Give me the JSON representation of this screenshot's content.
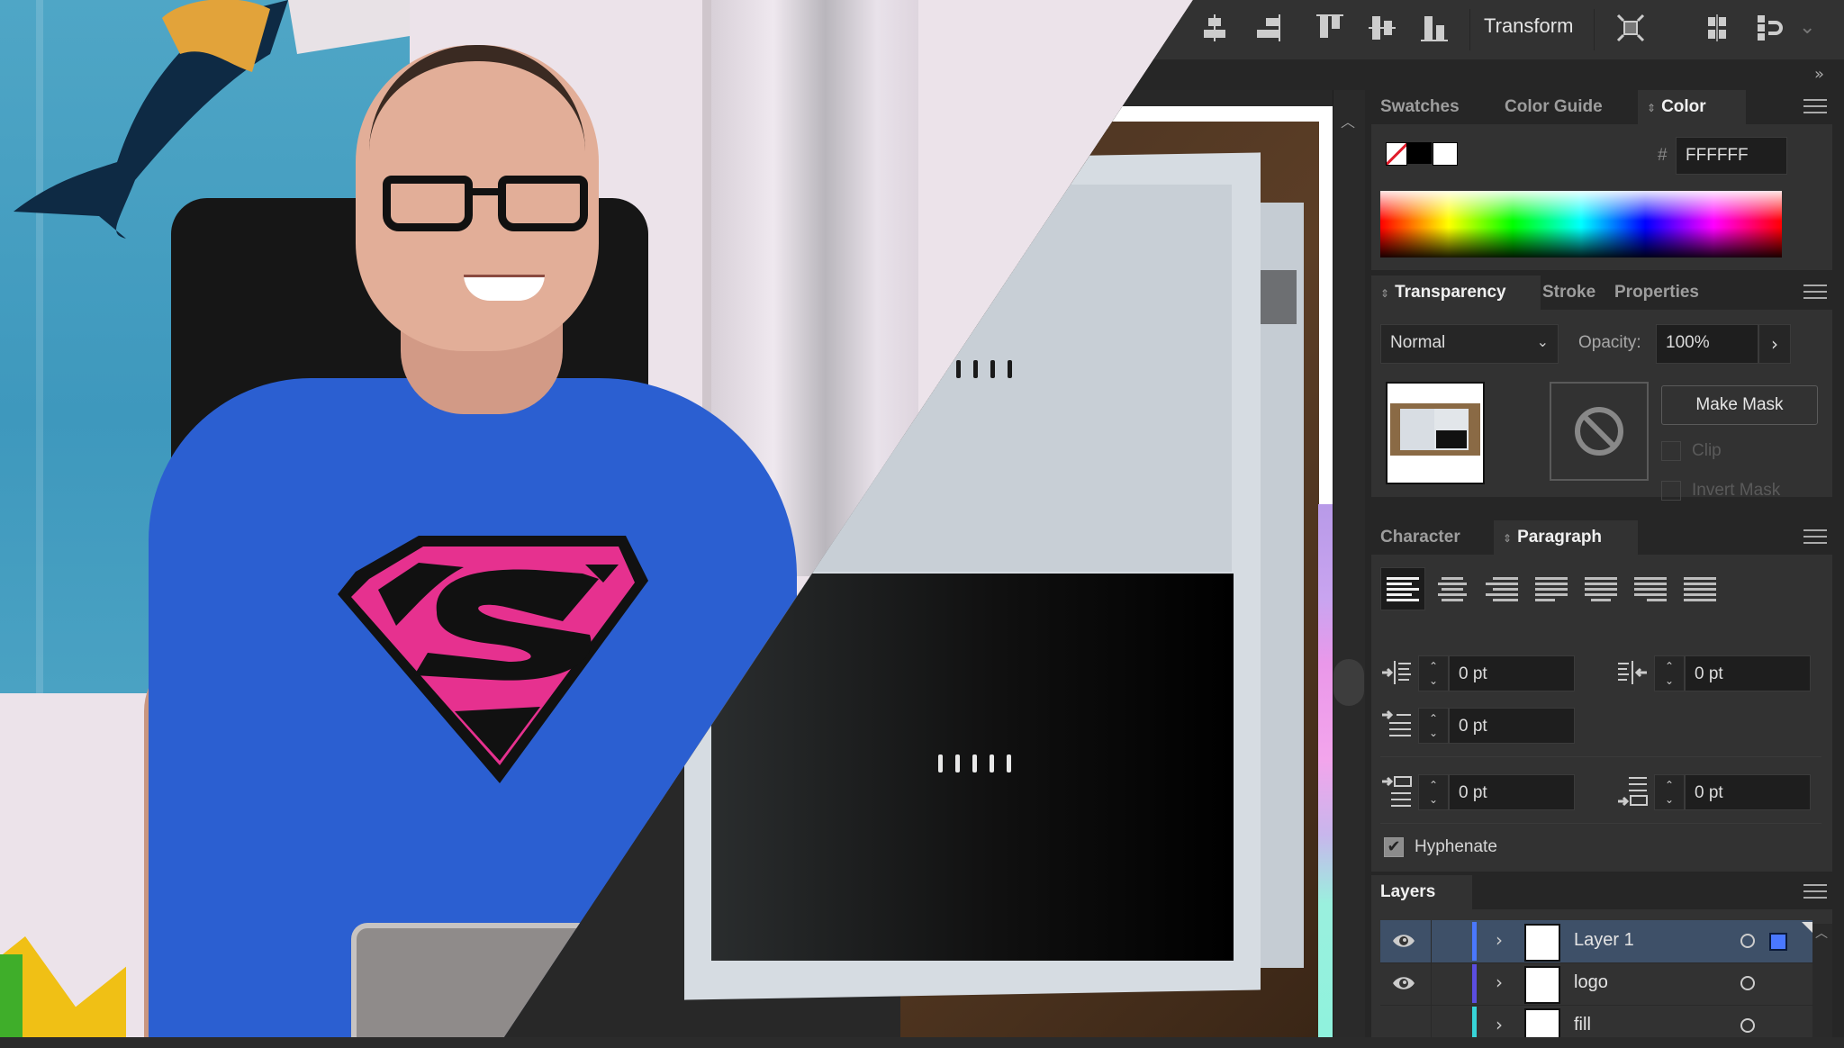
{
  "scene": {
    "description": "Presenter in a Supergirl-style t-shirt pointing at an Adobe Illustrator workspace split diagonally",
    "presenter_shirt_color": "#2b5fd1",
    "emblem_color": "#e6318f",
    "wall_color": "#ece3ea",
    "poster_color": "#4fa6c6"
  },
  "toolbar": {
    "icons": [
      {
        "name": "align-horizontal-center-icon"
      },
      {
        "name": "align-horizontal-right-icon"
      },
      {
        "name": "align-vertical-top-icon"
      },
      {
        "name": "align-vertical-center-icon"
      },
      {
        "name": "align-vertical-bottom-icon"
      }
    ],
    "transform_label": "Transform",
    "icons_after": [
      {
        "name": "isolate-selection-icon"
      },
      {
        "name": "distribute-spacing-icon"
      },
      {
        "name": "snap-magnet-icon"
      }
    ],
    "more_label": "⌄",
    "collapse_label": "»"
  },
  "color_panel": {
    "tabs": [
      {
        "label": "Swatches",
        "active": false
      },
      {
        "label": "Color Guide",
        "active": false
      },
      {
        "label": "Color",
        "active": true
      }
    ],
    "hash_label": "#",
    "hex_value": "FFFFFF",
    "fill_stroke": {
      "none": "none",
      "stroke": "#000000",
      "fill": "#FFFFFF"
    }
  },
  "transparency_panel": {
    "tabs": [
      {
        "label": "Transparency",
        "active": true
      },
      {
        "label": "Stroke",
        "active": false
      },
      {
        "label": "Properties",
        "active": false
      }
    ],
    "blend_mode": "Normal",
    "opacity_label": "Opacity:",
    "opacity_value": "100%",
    "make_mask_label": "Make Mask",
    "clip_label": "Clip",
    "invert_mask_label": "Invert Mask"
  },
  "paragraph_panel": {
    "tabs": [
      {
        "label": "Character",
        "active": false
      },
      {
        "label": "Paragraph",
        "active": true
      }
    ],
    "align_buttons": [
      {
        "name": "align-left",
        "active": true
      },
      {
        "name": "align-center",
        "active": false
      },
      {
        "name": "align-right",
        "active": false
      },
      {
        "name": "justify-last-left",
        "active": false
      },
      {
        "name": "justify-last-center",
        "active": false
      },
      {
        "name": "justify-last-right",
        "active": false
      },
      {
        "name": "justify-all",
        "active": false
      }
    ],
    "left_indent": "0 pt",
    "right_indent": "0 pt",
    "first_line_indent": "0 pt",
    "space_before": "0 pt",
    "space_after": "0 pt",
    "hyphenate_label": "Hyphenate",
    "hyphenate_checked": true
  },
  "layers_panel": {
    "tab_label": "Layers",
    "layers": [
      {
        "name": "Layer 1",
        "visible": true,
        "selected": true,
        "color": "#4a78ff"
      },
      {
        "name": "logo",
        "visible": true,
        "selected": false,
        "color": "#5b4de0"
      },
      {
        "name": "fill",
        "visible": false,
        "selected": false,
        "color": "#37d4d8"
      }
    ]
  },
  "artwork": {
    "top_ticks": 4,
    "bottom_ticks": 5
  }
}
